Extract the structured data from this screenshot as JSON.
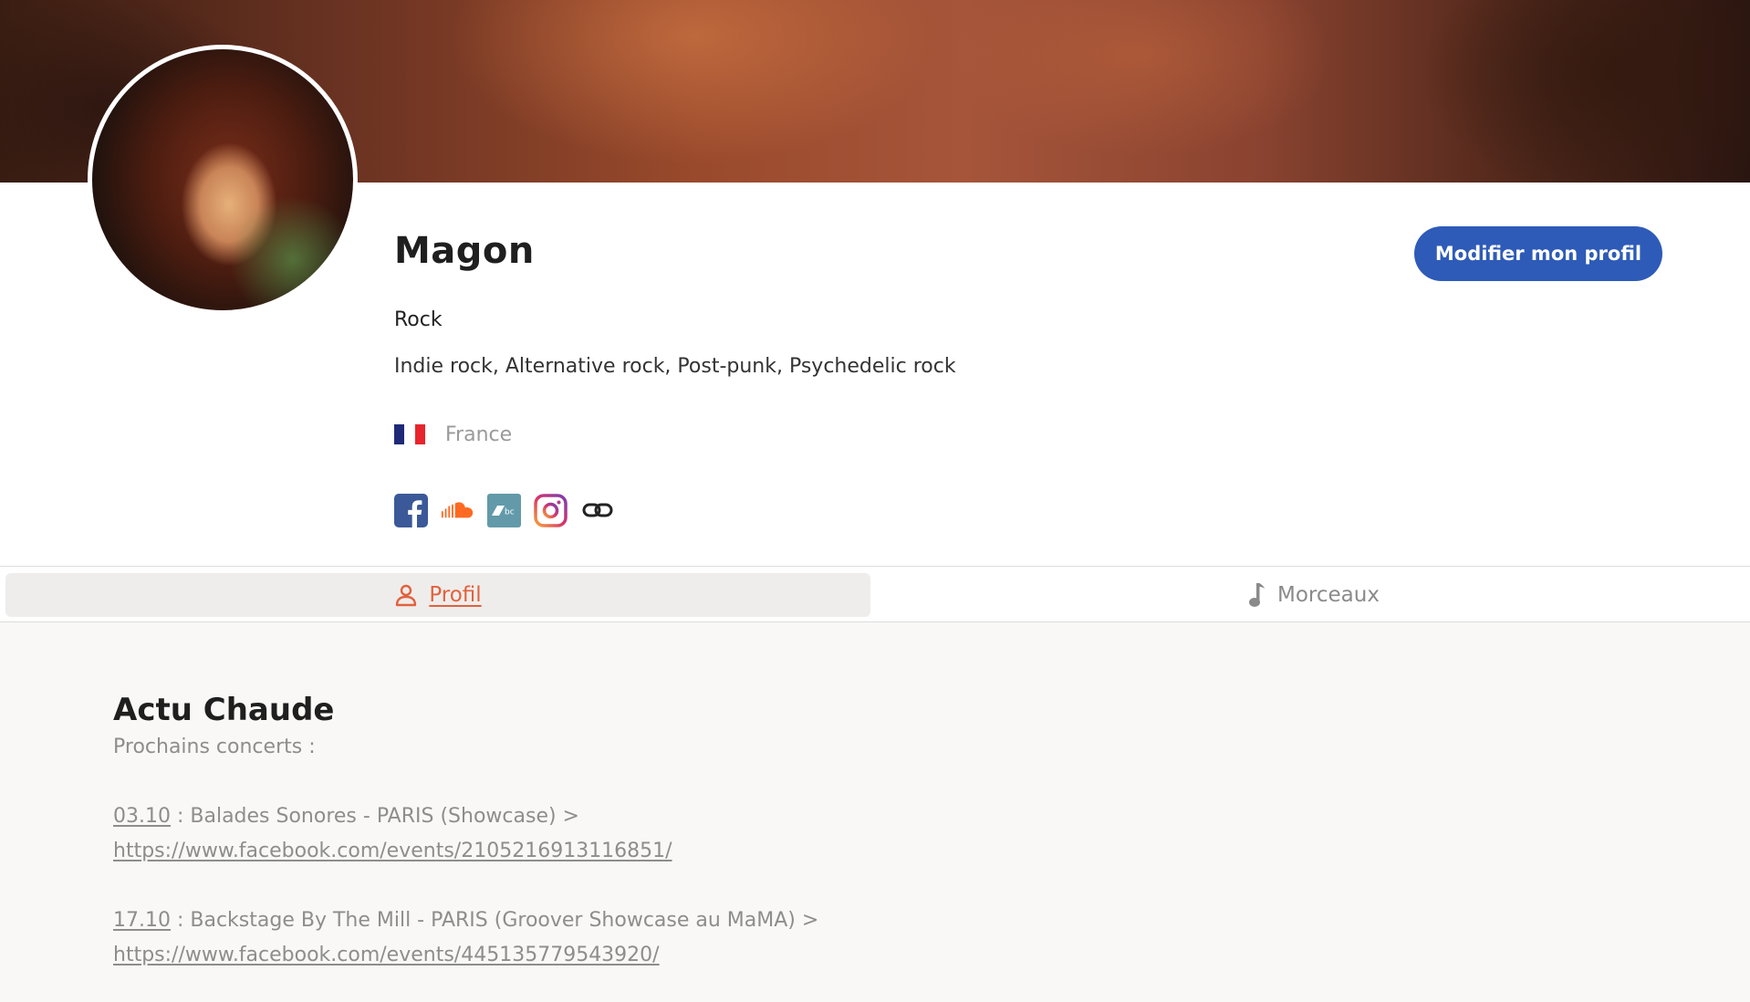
{
  "profile": {
    "name": "Magon",
    "genre": "Rock",
    "subgenres": "Indie rock, Alternative rock, Post-punk, Psychedelic rock",
    "country": "France",
    "country_flag_colors": [
      "#1e2a78",
      "#ffffff",
      "#e8242c"
    ],
    "edit_button_label": "Modifier mon profil",
    "socials": [
      {
        "icon": "facebook-icon",
        "color": "#3b5998"
      },
      {
        "icon": "soundcloud-icon",
        "color": "#ff6a22"
      },
      {
        "icon": "bandcamp-icon",
        "color": "#629aa9"
      },
      {
        "icon": "instagram-icon",
        "color": "#c13584"
      },
      {
        "icon": "link-icon",
        "color": "#222222"
      }
    ]
  },
  "tabs": [
    {
      "label": "Profil",
      "icon": "user-icon",
      "active": true
    },
    {
      "label": "Morceaux",
      "icon": "music-note-icon",
      "active": false
    }
  ],
  "section": {
    "title": "Actu Chaude",
    "subtitle": "Prochains concerts :",
    "events": [
      {
        "date": "03.10",
        "description": " : Balades Sonores - PARIS (Showcase) >",
        "link": "https://www.facebook.com/events/2105216913116851/"
      },
      {
        "date": "17.10",
        "description": " : Backstage By The Mill - PARIS (Groover Showcase au MaMA) >",
        "link": "https://www.facebook.com/events/445135779543920/"
      }
    ]
  },
  "colors": {
    "accent": "#e0623e",
    "primary_button": "#2e5bb8",
    "muted_text": "#8d8d8d"
  }
}
